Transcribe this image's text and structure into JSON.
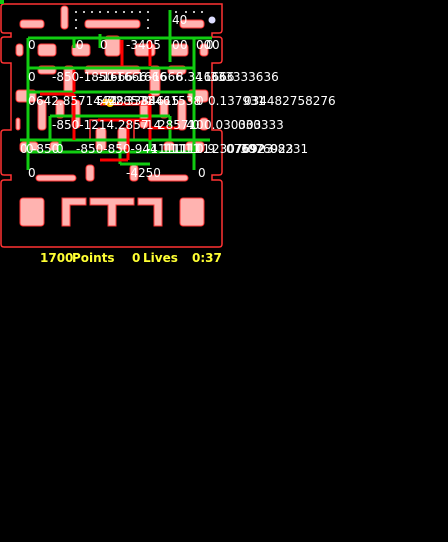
{
  "colors": {
    "background": "#000000",
    "wall_fill": "#ffb3b0",
    "wall_outline": "#ff3333",
    "path_green": "#11cc11",
    "path_red": "#ff0000",
    "label_text": "#ffffff",
    "hud_yellow": "#ffff33",
    "pellet": "#ffffff",
    "power_pellet": "#ddddff",
    "pacman": "#ffcc00"
  },
  "hud": {
    "score_value": "1700",
    "score_label": "Points",
    "lives_value": "0",
    "lives_label": "Lives",
    "timer": "0:37"
  },
  "path_labels": [
    "40",
    "0",
    "0",
    "0",
    "-3405",
    "0",
    "0",
    "00",
    "0",
    "0",
    "0",
    "-850-1850",
    "-1666",
    "-1666",
    "-1666",
    "-1666",
    "8.34",
    "1666",
    "1666",
    "333333636",
    "0",
    "642.85714428",
    "571",
    "428571",
    "3384615",
    "38461538",
    "0",
    "0.137931",
    "034482758276",
    "-850-1214.2857",
    "14",
    "28571",
    "4",
    "0",
    "0",
    "0.030303",
    "030333",
    "0",
    "0",
    "-850",
    "0",
    "-850-850-944",
    "-11111",
    "11111",
    "11111",
    "0.9",
    "23076923",
    "07692",
    "3076923",
    "08231",
    "0",
    "-4250",
    "0"
  ],
  "icons": [
    "pacman-icon",
    "ghost-icon",
    "pellet-icon",
    "power-pellet-icon"
  ]
}
